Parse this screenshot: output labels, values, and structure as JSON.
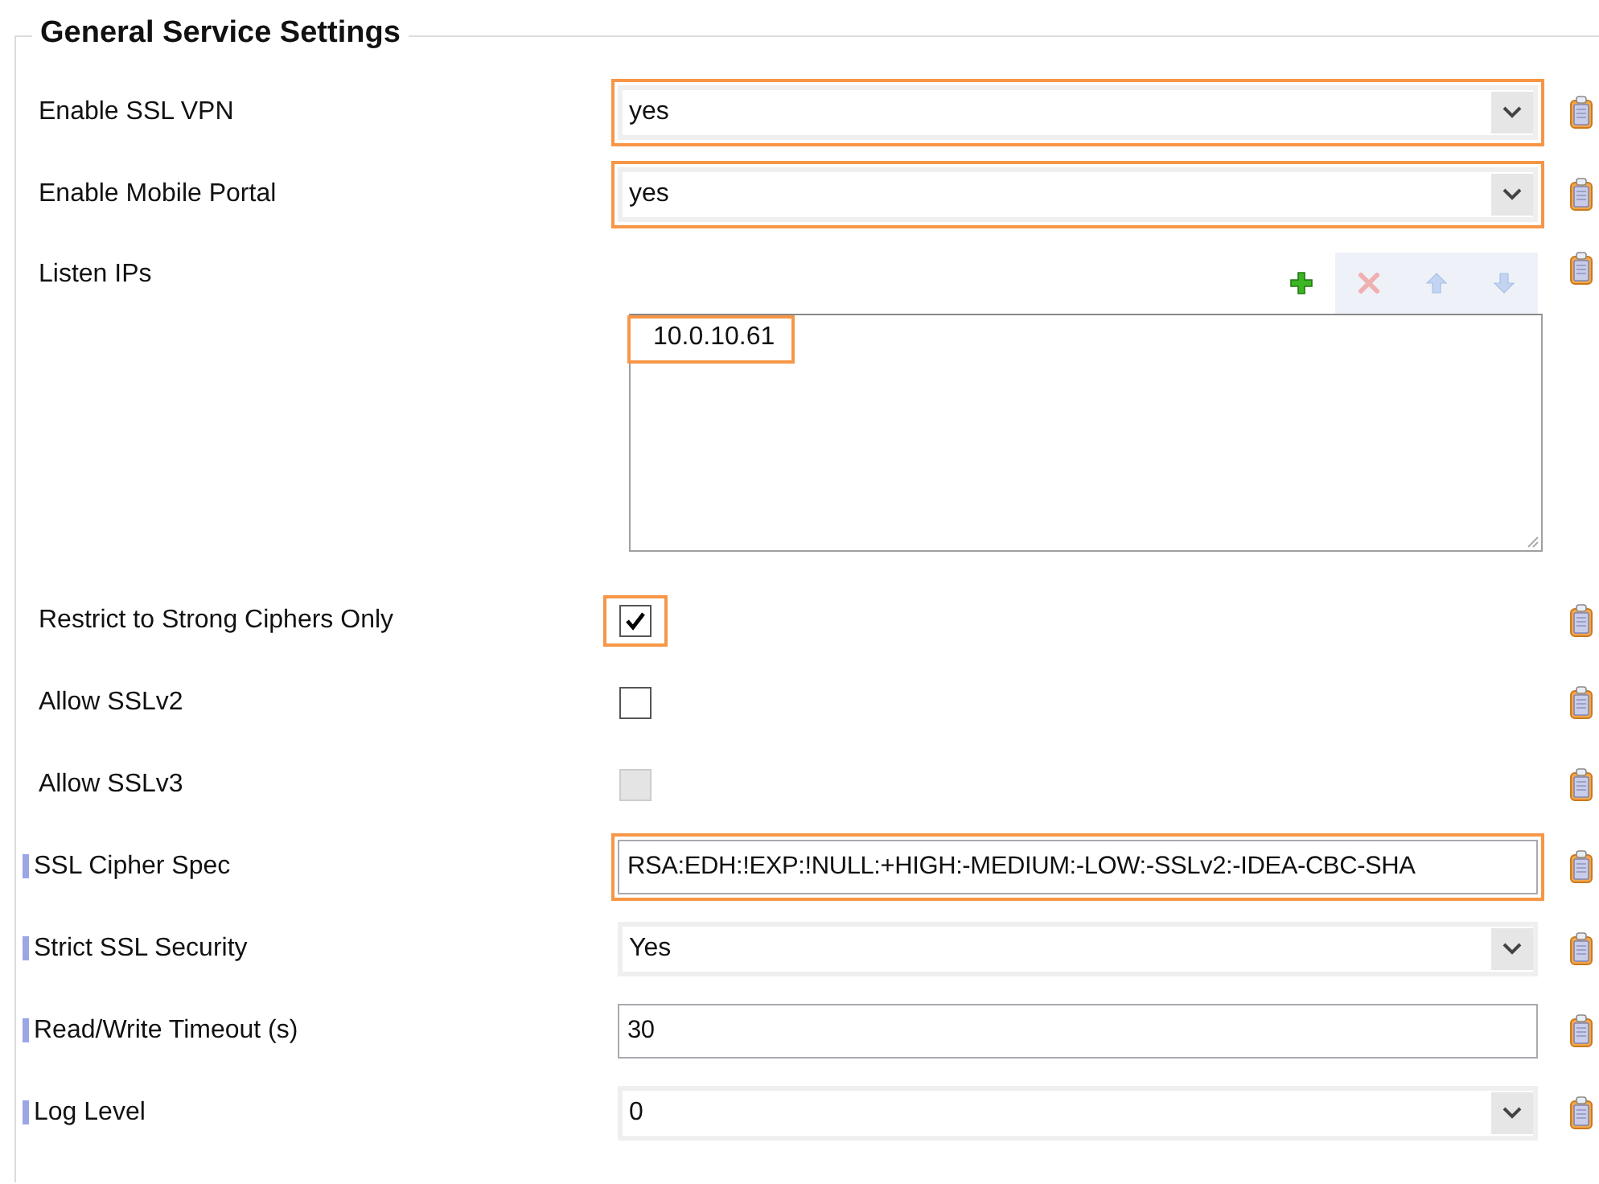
{
  "group": {
    "title": "General Service Settings"
  },
  "rows": [
    {
      "kind": "select",
      "label": "Enable SSL VPN",
      "value": "yes",
      "highlighted": true,
      "flag": false
    },
    {
      "kind": "select",
      "label": "Enable Mobile Portal",
      "value": "yes",
      "highlighted": true,
      "flag": false
    },
    {
      "kind": "list",
      "label": "Listen IPs",
      "flag": false,
      "toolbar": [
        {
          "kind": "add",
          "disabled": false
        },
        {
          "kind": "delete",
          "disabled": true
        },
        {
          "kind": "up",
          "disabled": true
        },
        {
          "kind": "down",
          "disabled": true
        }
      ],
      "items": [
        {
          "text": "10.0.10.61",
          "highlighted": true
        }
      ]
    },
    {
      "kind": "checkbox",
      "label": "Restrict to Strong Ciphers Only",
      "checked": true,
      "disabled": false,
      "highlighted": true,
      "flag": false
    },
    {
      "kind": "checkbox",
      "label": "Allow SSLv2",
      "checked": false,
      "disabled": false,
      "highlighted": false,
      "flag": false
    },
    {
      "kind": "checkbox",
      "label": "Allow SSLv3",
      "checked": false,
      "disabled": true,
      "highlighted": false,
      "flag": false
    },
    {
      "kind": "text",
      "label": "SSL Cipher Spec",
      "value": "RSA:EDH:!EXP:!NULL:+HIGH:-MEDIUM:-LOW:-SSLv2:-IDEA-CBC-SHA",
      "highlighted": true,
      "flag": true
    },
    {
      "kind": "select",
      "label": "Strict SSL Security",
      "value": "Yes",
      "highlighted": false,
      "flag": true
    },
    {
      "kind": "text",
      "label": "Read/Write Timeout (s)",
      "value": "30",
      "highlighted": false,
      "flag": true
    },
    {
      "kind": "select",
      "label": "Log Level",
      "value": "0",
      "highlighted": false,
      "flag": true
    }
  ]
}
